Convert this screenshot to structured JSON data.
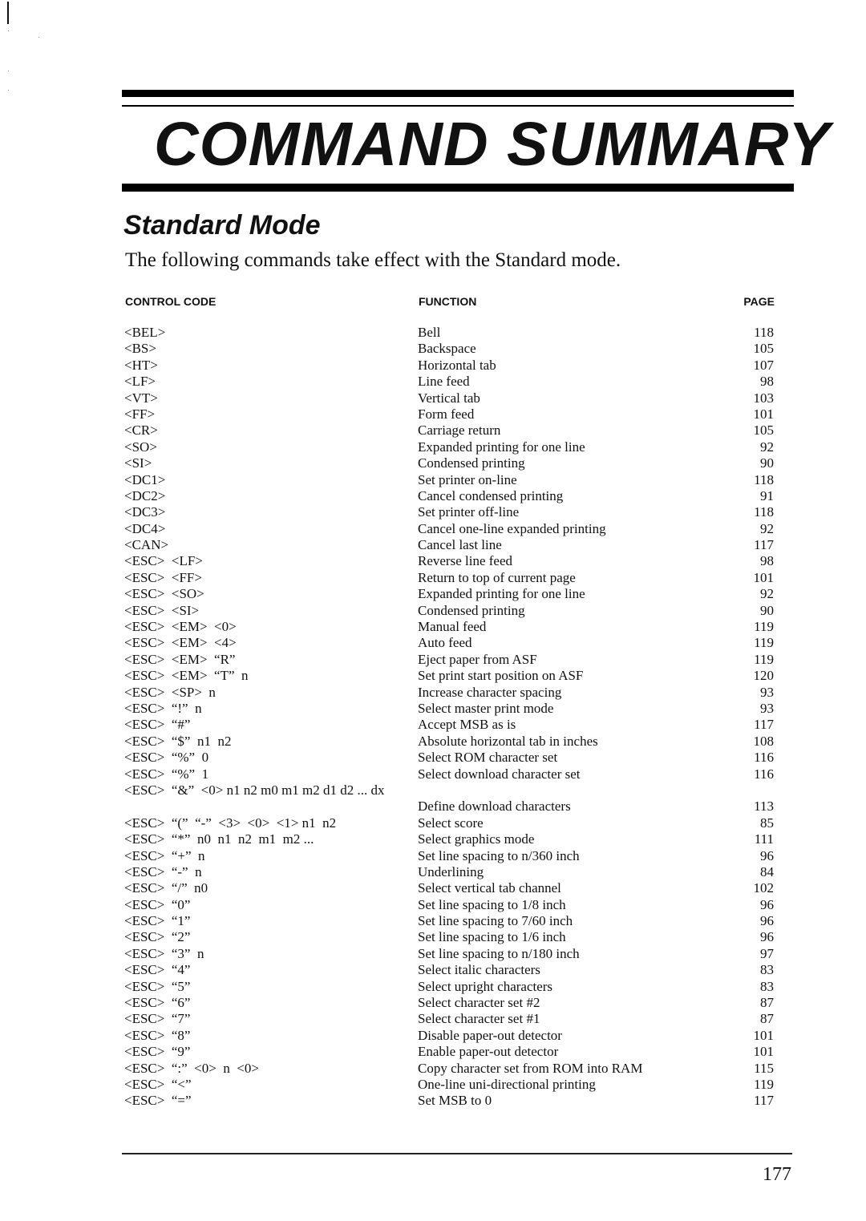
{
  "header": {
    "title": "COMMAND SUMMARY"
  },
  "section": {
    "title": "Standard Mode",
    "intro": "The following commands take effect with the Standard mode."
  },
  "table": {
    "columns": {
      "control_code": "CONTROL CODE",
      "function": "FUNCTION",
      "page": "PAGE"
    },
    "rows": [
      {
        "code": "<BEL>",
        "function": "Bell",
        "page": "118"
      },
      {
        "code": "<BS>",
        "function": "Backspace",
        "page": "105"
      },
      {
        "code": "<HT>",
        "function": "Horizontal tab",
        "page": "107"
      },
      {
        "code": "<LF>",
        "function": "Line feed",
        "page": "98"
      },
      {
        "code": "<VT>",
        "function": "Vertical tab",
        "page": "103"
      },
      {
        "code": "<FF>",
        "function": "Form feed",
        "page": "101"
      },
      {
        "code": "<CR>",
        "function": "Carriage return",
        "page": "105"
      },
      {
        "code": "<SO>",
        "function": "Expanded printing for one line",
        "page": "92"
      },
      {
        "code": "<SI>",
        "function": "Condensed printing",
        "page": "90"
      },
      {
        "code": "<DC1>",
        "function": "Set printer on-line",
        "page": "118"
      },
      {
        "code": "<DC2>",
        "function": "Cancel condensed printing",
        "page": "91"
      },
      {
        "code": "<DC3>",
        "function": "Set printer off-line",
        "page": "118"
      },
      {
        "code": "<DC4>",
        "function": "Cancel one-line expanded printing",
        "page": "92"
      },
      {
        "code": "<CAN>",
        "function": "Cancel last line",
        "page": "117"
      },
      {
        "code": "<ESC>  <LF>",
        "function": "Reverse line feed",
        "page": "98"
      },
      {
        "code": "<ESC>  <FF>",
        "function": "Return to top of current page",
        "page": "101"
      },
      {
        "code": "<ESC>  <SO>",
        "function": "Expanded printing for one line",
        "page": "92"
      },
      {
        "code": "<ESC>  <SI>",
        "function": "Condensed printing",
        "page": "90"
      },
      {
        "code": "<ESC>  <EM>  <0>",
        "function": "Manual feed",
        "page": "119"
      },
      {
        "code": "<ESC>  <EM>  <4>",
        "function": "Auto feed",
        "page": "119"
      },
      {
        "code": "<ESC>  <EM>  “R”",
        "function": "Eject paper from ASF",
        "page": "119"
      },
      {
        "code": "<ESC>  <EM>  “T”  n",
        "function": "Set print start position on ASF",
        "page": "120"
      },
      {
        "code": "<ESC>  <SP>  n",
        "function": "Increase character spacing",
        "page": "93"
      },
      {
        "code": "<ESC>  “!”  n",
        "function": "Select master print mode",
        "page": "93"
      },
      {
        "code": "<ESC>  “#”",
        "function": "Accept MSB as is",
        "page": "117"
      },
      {
        "code": "<ESC>  “$”  n1  n2",
        "function": "Absolute horizontal tab in inches",
        "page": "108"
      },
      {
        "code": "<ESC>  “%”  0",
        "function": "Select ROM character set",
        "page": "116"
      },
      {
        "code": "<ESC>  “%”  1",
        "function": "Select download character set",
        "page": "116"
      },
      {
        "code": "<ESC>  “&”  <0> n1 n2 m0 m1 m2 d1 d2 ... dx",
        "function": "Define download characters",
        "page": "113",
        "wrapped": true
      },
      {
        "code": "<ESC>  “(”  “-”  <3>  <0>  <1> n1  n2",
        "function": "Select score",
        "page": "85"
      },
      {
        "code": "<ESC>  “*”  n0  n1  n2  m1  m2 ...",
        "function": "Select graphics mode",
        "page": "111"
      },
      {
        "code": "<ESC>  “+”  n",
        "function": "Set line spacing to n/360 inch",
        "page": "96"
      },
      {
        "code": "<ESC>  “-”  n",
        "function": "Underlining",
        "page": "84"
      },
      {
        "code": "<ESC>  “/”  n0",
        "function": "Select vertical tab channel",
        "page": "102"
      },
      {
        "code": "<ESC>  “0”",
        "function": "Set line spacing to 1/8 inch",
        "page": "96"
      },
      {
        "code": "<ESC>  “1”",
        "function": "Set line spacing to 7/60 inch",
        "page": "96"
      },
      {
        "code": "<ESC>  “2”",
        "function": "Set line spacing to 1/6 inch",
        "page": "96"
      },
      {
        "code": "<ESC>  “3”  n",
        "function": "Set line spacing to n/180 inch",
        "page": "97"
      },
      {
        "code": "<ESC>  “4”",
        "function": "Select italic characters",
        "page": "83"
      },
      {
        "code": "<ESC>  “5”",
        "function": "Select upright characters",
        "page": "83"
      },
      {
        "code": "<ESC>  “6”",
        "function": "Select character set #2",
        "page": "87"
      },
      {
        "code": "<ESC>  “7”",
        "function": "Select character set #1",
        "page": "87"
      },
      {
        "code": "<ESC>  “8”",
        "function": "Disable paper-out detector",
        "page": "101"
      },
      {
        "code": "<ESC>  “9”",
        "function": "Enable paper-out detector",
        "page": "101"
      },
      {
        "code": "<ESC>  “:”  <0>  n  <0>",
        "function": "Copy character set from ROM into RAM",
        "page": "115"
      },
      {
        "code": "<ESC>  “<”",
        "function": "One-line uni-directional printing",
        "page": "119"
      },
      {
        "code": "<ESC>  “=”",
        "function": "Set MSB to 0",
        "page": "117"
      }
    ]
  },
  "footer": {
    "page_number": "177"
  }
}
